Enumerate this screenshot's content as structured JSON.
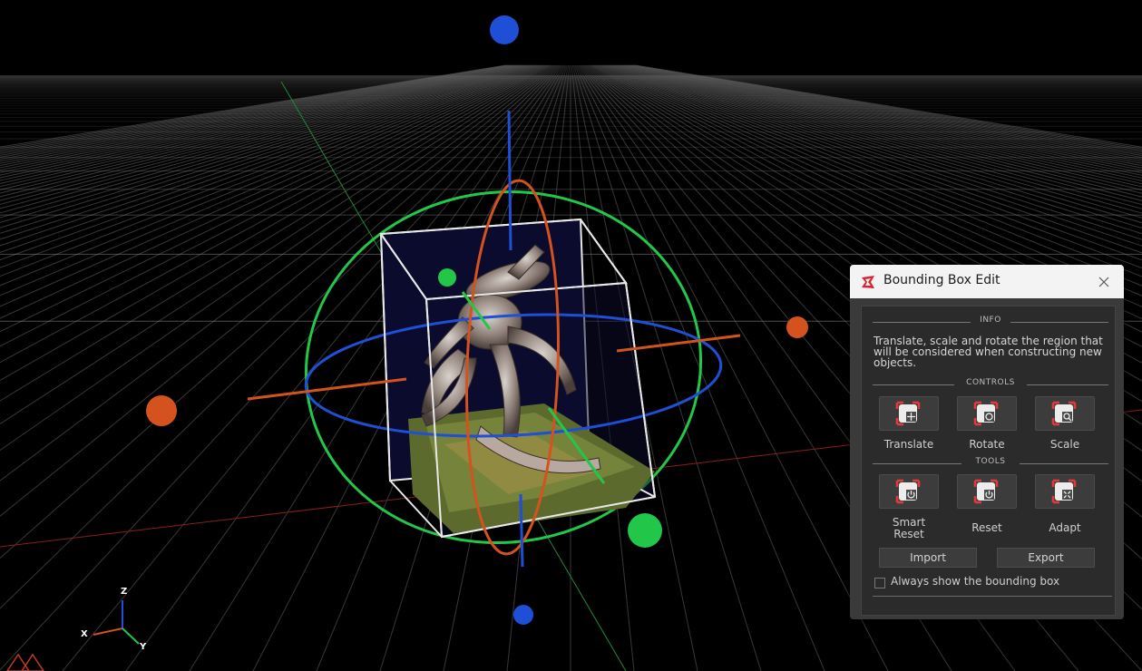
{
  "window": {
    "title": "Bounding Box Edit",
    "close_label": "✕"
  },
  "info": {
    "header": "INFO",
    "text": "Translate, scale and rotate the region that will be considered when constructing new objects."
  },
  "controls": {
    "header": "CONTROLS",
    "items": [
      {
        "label": "Translate",
        "icon": "translate-icon"
      },
      {
        "label": "Rotate",
        "icon": "rotate-icon"
      },
      {
        "label": "Scale",
        "icon": "scale-icon"
      }
    ]
  },
  "tools": {
    "header": "TOOLS",
    "items": [
      {
        "label": "Smart Reset",
        "icon": "smart-reset-icon"
      },
      {
        "label": "Reset",
        "icon": "reset-icon"
      },
      {
        "label": "Adapt",
        "icon": "adapt-icon"
      }
    ]
  },
  "buttons": {
    "import": "Import",
    "export": "Export"
  },
  "options": {
    "always_show_label": "Always show the bounding box",
    "always_show_checked": false
  },
  "axis_gizmo": {
    "x": "X",
    "y": "Y",
    "z": "Z"
  },
  "colors": {
    "x_axis": "#d4521e",
    "y_axis": "#22c74a",
    "z_axis": "#1f4fd6",
    "accent": "#d9232d",
    "panel_bg": "#2b2b2b"
  }
}
